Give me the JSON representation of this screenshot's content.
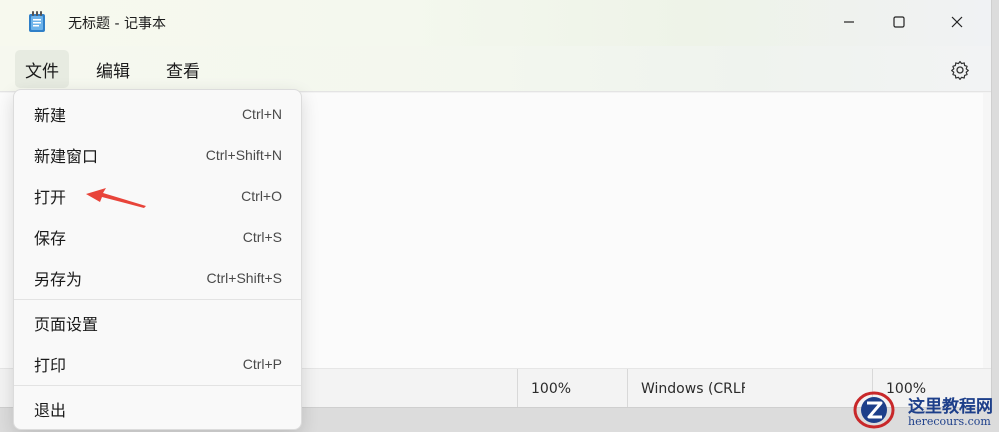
{
  "window": {
    "title": "无标题 - 记事本",
    "icon": "notepad-icon"
  },
  "menubar": {
    "file": "文件",
    "edit": "编辑",
    "view": "查看",
    "settings_icon": "gear-icon"
  },
  "file_menu": {
    "items": [
      {
        "label": "新建",
        "shortcut": "Ctrl+N"
      },
      {
        "label": "新建窗口",
        "shortcut": "Ctrl+Shift+N"
      },
      {
        "label": "打开",
        "shortcut": "Ctrl+O"
      },
      {
        "label": "保存",
        "shortcut": "Ctrl+S"
      },
      {
        "label": "另存为",
        "shortcut": "Ctrl+Shift+S"
      },
      {
        "label": "页面设置",
        "shortcut": ""
      },
      {
        "label": "打印",
        "shortcut": "Ctrl+P"
      },
      {
        "label": "退出",
        "shortcut": ""
      }
    ]
  },
  "statusbar": {
    "zoom": "100%",
    "line_ending": "Windows (CRLF)",
    "encoding": "100%"
  },
  "annotation": {
    "color": "#e8443a",
    "target": "打开"
  },
  "watermark": {
    "text": "这里教程网",
    "url": "herecours.com",
    "color": "#1d3f8a"
  }
}
